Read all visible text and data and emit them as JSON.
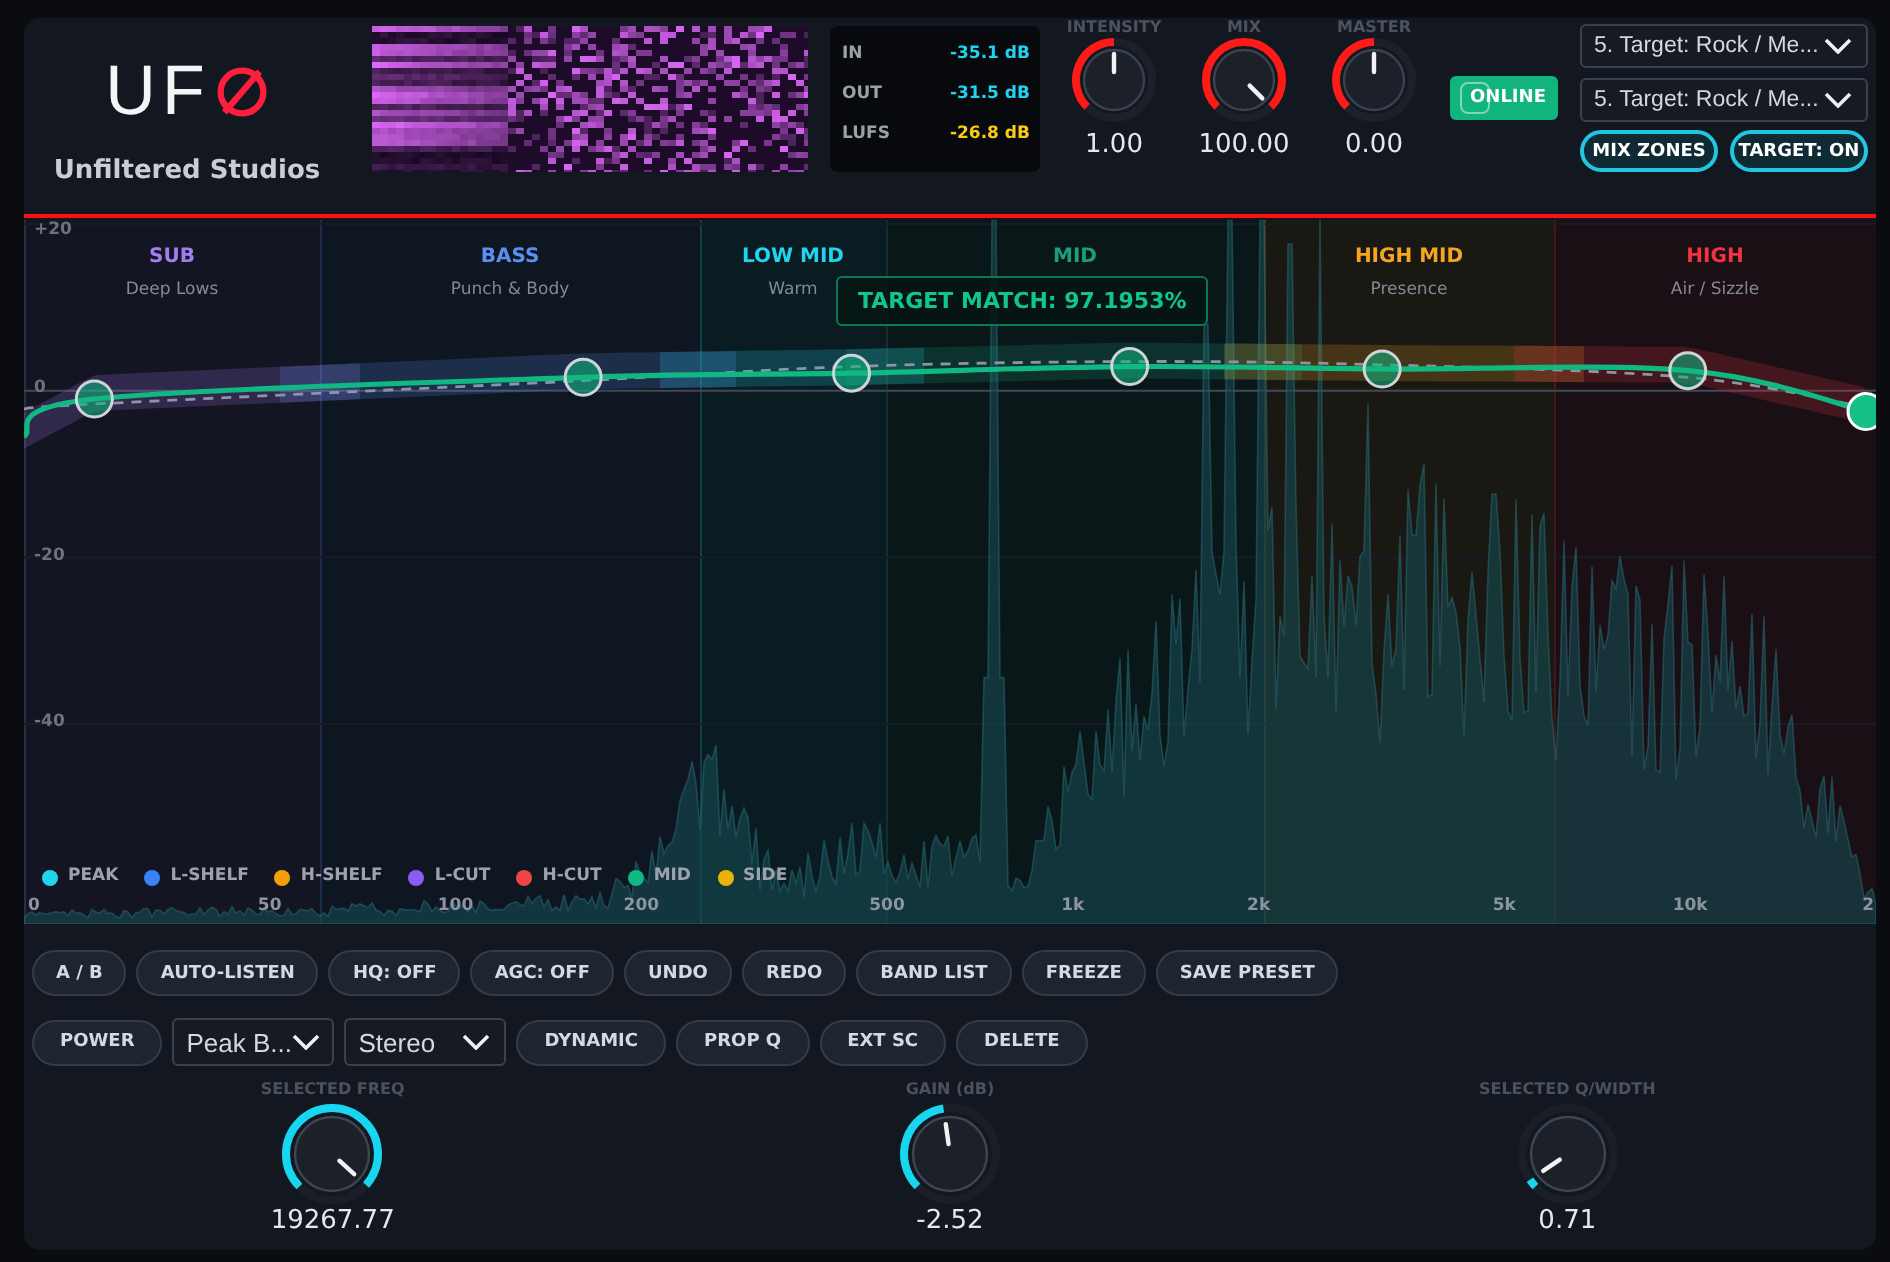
{
  "header": {
    "logo": "UF",
    "brand": "Unfiltered Studios"
  },
  "meters": [
    {
      "label": "IN",
      "reading": "-35.1 dB",
      "color": "#22d3ee"
    },
    {
      "label": "OUT",
      "reading": "-31.5 dB",
      "color": "#22d3ee"
    },
    {
      "label": "LUFS",
      "reading": "-26.8 dB",
      "color": "#facc15"
    }
  ],
  "master_knobs": [
    {
      "label": "INTENSITY",
      "value": "1.00",
      "level": 0.5
    },
    {
      "label": "MIX",
      "value": "100.00",
      "level": 1
    },
    {
      "label": "MASTER",
      "value": "0.00",
      "level": 0.5
    }
  ],
  "online_button": {
    "label": "ONLINE"
  },
  "target_selects": [
    {
      "value": "5. Target: Rock / Me..."
    },
    {
      "value": "5. Target: Rock / Me..."
    }
  ],
  "view_toggles": [
    {
      "label": "MIX ZONES",
      "on": true
    },
    {
      "label": "TARGET: ON",
      "on": true
    }
  ],
  "eq": {
    "zones": [
      {
        "name": "SUB",
        "description": "Deep Lows",
        "color": "#a07ef0"
      },
      {
        "name": "BASS",
        "description": "Punch & Body",
        "color": "#5b8ff0"
      },
      {
        "name": "LOW MID",
        "description": "Warm",
        "color": "#22d3ee"
      },
      {
        "name": "MID",
        "color": "#1f9d7a"
      },
      {
        "name": "HIGH MID",
        "description": "Presence",
        "color": "#f5a524"
      },
      {
        "name": "HIGH",
        "description": "Air / Sizzle",
        "color": "#ef3340"
      }
    ],
    "target_match": "TARGET MATCH: 97.1953%",
    "bands": [
      {
        "selected": false
      },
      {
        "selected": false
      },
      {
        "selected": false
      },
      {
        "selected": false
      },
      {
        "selected": false
      },
      {
        "selected": false
      },
      {
        "selected": true
      }
    ],
    "y_axis_labels": [
      "+20",
      "0",
      "-20",
      "-40"
    ],
    "x_axis_labels": [
      "0",
      "50",
      "100",
      "200",
      "500",
      "1k",
      "2k",
      "5k",
      "10k",
      "2"
    ],
    "legend": [
      {
        "label": "PEAK",
        "color": "#22d3ee"
      },
      {
        "label": "L-SHELF",
        "color": "#3b82f6"
      },
      {
        "label": "H-SHELF",
        "color": "#f59e0b"
      },
      {
        "label": "L-CUT",
        "color": "#8b5cf6"
      },
      {
        "label": "H-CUT",
        "color": "#ef4444"
      },
      {
        "label": "MID",
        "color": "#10b981"
      },
      {
        "label": "SIDE",
        "color": "#eab308"
      }
    ]
  },
  "toolbar_rows": [
    {
      "items": [
        {
          "kind": "button",
          "label": "A / B"
        },
        {
          "kind": "button",
          "label": "AUTO-LISTEN"
        },
        {
          "kind": "button",
          "label": "HQ: OFF"
        },
        {
          "kind": "button",
          "label": "AGC: OFF"
        },
        {
          "kind": "button",
          "label": "UNDO"
        },
        {
          "kind": "button",
          "label": "REDO"
        },
        {
          "kind": "button",
          "label": "BAND LIST"
        },
        {
          "kind": "button",
          "label": "FREEZE"
        },
        {
          "kind": "button",
          "label": "SAVE PRESET"
        }
      ]
    },
    {
      "items": [
        {
          "kind": "button",
          "label": "POWER"
        },
        {
          "kind": "select",
          "value": "Peak B..."
        },
        {
          "kind": "select",
          "value": "Stereo"
        },
        {
          "kind": "button",
          "label": "DYNAMIC"
        },
        {
          "kind": "button",
          "label": "PROP Q"
        },
        {
          "kind": "button",
          "label": "EXT SC"
        },
        {
          "kind": "button",
          "label": "DELETE"
        }
      ]
    }
  ],
  "band_controls": [
    {
      "label": "SELECTED FREQ",
      "value": "19267.77",
      "level": 0.99
    },
    {
      "label": "GAIN (dB)",
      "value": "-2.52",
      "level": 0.47
    },
    {
      "label": "SELECTED Q/WIDTH",
      "value": "0.71",
      "level": 0.04
    }
  ]
}
